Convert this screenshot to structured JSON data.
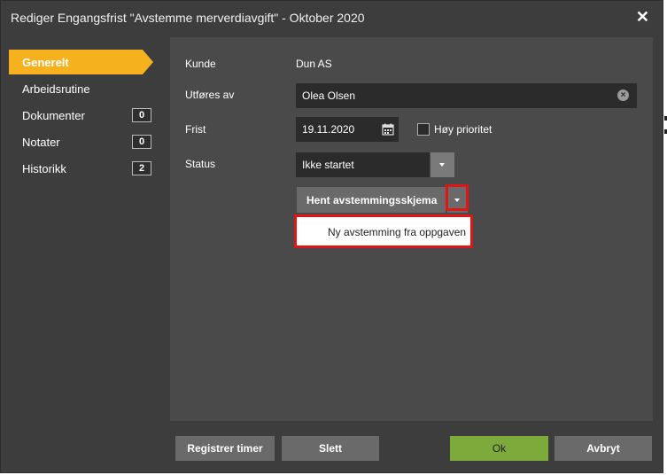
{
  "dialog": {
    "title": "Rediger Engangsfrist \"Avstemme merverdiavgift\" - Oktober 2020",
    "close_label": "✕"
  },
  "nav": {
    "items": [
      {
        "label": "Generelt",
        "badge": ""
      },
      {
        "label": "Arbeidsrutine",
        "badge": ""
      },
      {
        "label": "Dokumenter",
        "badge": "0"
      },
      {
        "label": "Notater",
        "badge": "0"
      },
      {
        "label": "Historikk",
        "badge": "2"
      }
    ]
  },
  "form": {
    "kunde_label": "Kunde",
    "kunde_value": "Dun AS",
    "utfores_label": "Utføres av",
    "utfores_value": "Olea Olsen",
    "frist_label": "Frist",
    "frist_value": "19.11.2020",
    "hoy_prioritet_label": "Høy prioritet",
    "status_label": "Status",
    "status_value": "Ikke startet",
    "hent_button_label": "Hent avstemmingsskjema",
    "menu_item_label": "Ny avstemming fra oppgaven"
  },
  "footer": {
    "registrer_label": "Registrer timer",
    "slett_label": "Slett",
    "ok_label": "Ok",
    "avbryt_label": "Avbryt"
  },
  "colors": {
    "accent": "#f5b21e",
    "ok_green": "#7cab3c",
    "highlight_red": "#e01515",
    "dialog_bg": "#3d3d3d"
  }
}
